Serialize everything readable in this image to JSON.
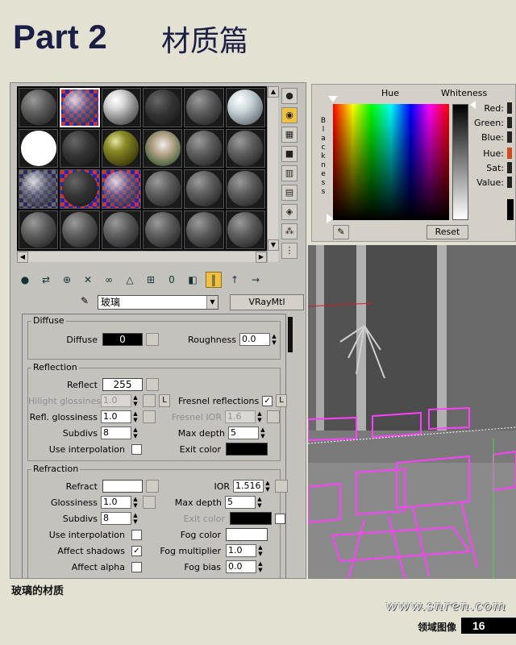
{
  "header": {
    "title": "Part 2",
    "subtitle": "材质篇"
  },
  "material_editor": {
    "material_name": "玻璃",
    "material_type": "VRayMtl",
    "diffuse": {
      "group_label": "Diffuse",
      "diffuse_label": "Diffuse",
      "diffuse_value": "0",
      "diffuse_color": "#000000",
      "roughness_label": "Roughness",
      "roughness_value": "0.0"
    },
    "reflection": {
      "group_label": "Reflection",
      "reflect_label": "Reflect",
      "reflect_value": "255",
      "reflect_color": "#ffffff",
      "hilight_label": "Hilight glossiness",
      "hilight_value": "1.0",
      "lock_label": "L",
      "fresnel_label": "Fresnel reflections",
      "fresnel_checked": "✓",
      "refl_gloss_label": "Refl. glossiness",
      "refl_gloss_value": "1.0",
      "fresnel_ior_label": "Fresnel IOR",
      "fresnel_ior_value": "1.6",
      "subdivs_label": "Subdivs",
      "subdivs_value": "8",
      "max_depth_label": "Max depth",
      "max_depth_value": "5",
      "use_interp_label": "Use interpolation",
      "exit_color_label": "Exit color",
      "exit_color": "#000000"
    },
    "refraction": {
      "group_label": "Refraction",
      "refract_label": "Refract",
      "refract_color": "#ffffff",
      "ior_label": "IOR",
      "ior_value": "1.516",
      "gloss_label": "Glossiness",
      "gloss_value": "1.0",
      "max_depth_label": "Max depth",
      "max_depth_value": "5",
      "subdivs_label": "Subdivs",
      "subdivs_value": "8",
      "exit_color_label": "Exit color",
      "exit_color": "#000000",
      "use_interp_label": "Use interpolation",
      "fog_color_label": "Fog color",
      "fog_color": "#ffffff",
      "affect_shadows_label": "Affect shadows",
      "affect_shadows_checked": "✓",
      "fog_mult_label": "Fog multiplier",
      "fog_mult_value": "1.0",
      "affect_alpha_label": "Affect alpha",
      "fog_bias_label": "Fog bias",
      "fog_bias_value": "0.0"
    }
  },
  "color_picker": {
    "hue_label": "Hue",
    "whiteness_label": "Whiteness",
    "blackness_label": "Blackness",
    "red_label": "Red:",
    "green_label": "Green:",
    "blue_label": "Blue:",
    "hue_field_label": "Hue:",
    "sat_label": "Sat:",
    "value_label": "Value:",
    "reset_label": "Reset"
  },
  "caption": "玻璃的材质",
  "watermark": "www.snren.com",
  "footer": {
    "section": "领域图像",
    "page": "16"
  }
}
